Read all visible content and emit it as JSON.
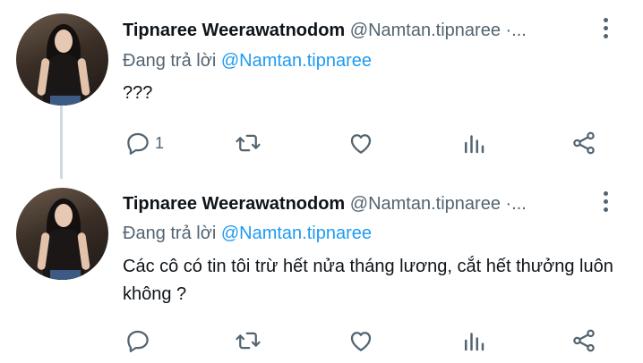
{
  "tweets": [
    {
      "name": "Tipnaree Weerawatnodom",
      "handle": "@Namtan.tipnaree ·...",
      "reply_prefix": "Đang trả lời",
      "reply_to": "@Namtan.tipnaree",
      "text": "???",
      "reply_count": "1"
    },
    {
      "name": "Tipnaree Weerawatnodom",
      "handle": "@Namtan.tipnaree ·...",
      "reply_prefix": "Đang trả lời",
      "reply_to": "@Namtan.tipnaree",
      "text": "Các cô có tin tôi trừ hết nửa tháng lương, cắt hết thưởng luôn không ?",
      "reply_count": ""
    }
  ],
  "icons": [
    "reply-icon",
    "retweet-icon",
    "like-icon",
    "views-icon",
    "share-icon",
    "more-icon"
  ],
  "colors": {
    "text": "#0f1419",
    "muted": "#536471",
    "link": "#1d9bf0",
    "thread": "#cfd9de"
  }
}
